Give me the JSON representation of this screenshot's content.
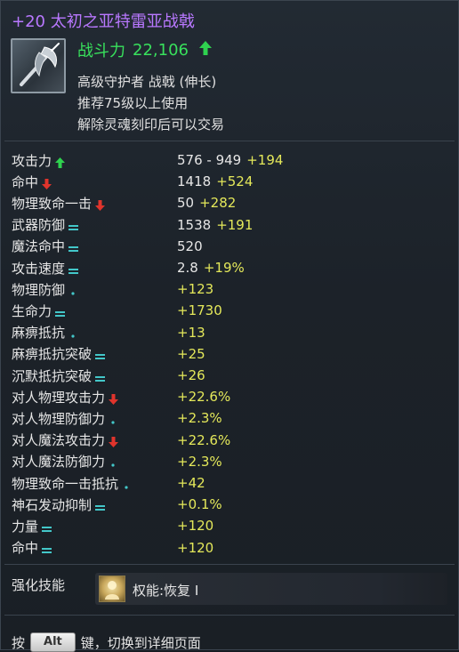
{
  "item": {
    "title": "+20 太初之亚特雷亚战戟",
    "icon": "halberd-icon",
    "power_label": "战斗力",
    "power_value": "22,106",
    "power_trend": "up",
    "grade_line": "高级守护者 战戟 (伸长)",
    "level_line": "推荐75级以上使用",
    "trade_line": "解除灵魂刻印后可以交易"
  },
  "stats": [
    {
      "name": "攻击力",
      "indicator": "up",
      "base": "576 - 949",
      "bonus": "+194"
    },
    {
      "name": "命中",
      "indicator": "down",
      "base": "1418",
      "bonus": "+524"
    },
    {
      "name": "物理致命一击",
      "indicator": "down",
      "base": "50",
      "bonus": "+282"
    },
    {
      "name": "武器防御",
      "indicator": "equal",
      "base": "1538",
      "bonus": "+191"
    },
    {
      "name": "魔法命中",
      "indicator": "equal",
      "base": "520",
      "bonus": ""
    },
    {
      "name": "攻击速度",
      "indicator": "equal",
      "base": "2.8",
      "bonus": "+19%"
    },
    {
      "name": "物理防御",
      "indicator": "dot",
      "base": "",
      "bonus": "+123"
    },
    {
      "name": "生命力",
      "indicator": "equal",
      "base": "",
      "bonus": "+1730"
    },
    {
      "name": "麻痹抵抗",
      "indicator": "dot",
      "base": "",
      "bonus": "+13"
    },
    {
      "name": "麻痹抵抗突破",
      "indicator": "equal",
      "base": "",
      "bonus": "+25"
    },
    {
      "name": "沉默抵抗突破",
      "indicator": "equal",
      "base": "",
      "bonus": "+26"
    },
    {
      "name": "对人物理攻击力",
      "indicator": "down",
      "base": "",
      "bonus": "+22.6%"
    },
    {
      "name": "对人物理防御力",
      "indicator": "dot",
      "base": "",
      "bonus": "+2.3%"
    },
    {
      "name": "对人魔法攻击力",
      "indicator": "down",
      "base": "",
      "bonus": "+22.6%"
    },
    {
      "name": "对人魔法防御力",
      "indicator": "dot",
      "base": "",
      "bonus": "+2.3%"
    },
    {
      "name": "物理致命一击抵抗",
      "indicator": "dot",
      "base": "",
      "bonus": "+42"
    },
    {
      "name": "神石发动抑制",
      "indicator": "equal",
      "base": "",
      "bonus": "+0.1%"
    },
    {
      "name": "力量",
      "indicator": "equal",
      "base": "",
      "bonus": "+120"
    },
    {
      "name": "命中",
      "indicator": "equal",
      "base": "",
      "bonus": "+120"
    }
  ],
  "enhancement": {
    "label": "强化技能",
    "skill_icon": "skill-portrait-icon",
    "skill_name": "权能:恢复 I"
  },
  "footer": {
    "prefix": "按",
    "key": "Alt",
    "suffix": "键，切换到详细页面"
  },
  "colors": {
    "title": "#b978ff",
    "power": "#38e05c",
    "bonus": "#e4e85a",
    "up": "#2fd24f",
    "down": "#e0342c",
    "equal": "#43c7c9"
  }
}
